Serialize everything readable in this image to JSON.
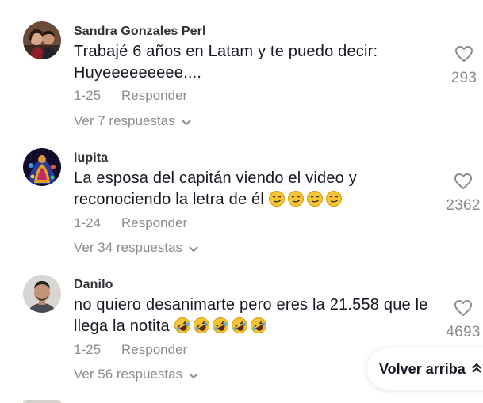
{
  "comments": [
    {
      "author": "Sandra Gonzales Perl",
      "line1": "Trabajé 6 años en Latam y te puedo decir:",
      "line2": "Huyeeeeeeeee....",
      "date": "1-25",
      "reply_label": "Responder",
      "replies_label": "Ver 7 respuestas",
      "likes": "293",
      "emoji_count": 0
    },
    {
      "author": "lupita",
      "line1": "La esposa del capitán viendo el video y",
      "line2": "reconociendo la letra de él",
      "date": "1-24",
      "reply_label": "Responder",
      "replies_label": "Ver 34 respuestas",
      "likes": "2362",
      "emoji": "smirk-emoji",
      "emoji_count": 4
    },
    {
      "author": "Danilo",
      "line1": "no quiero desanimarte pero eres la 21.558 que le",
      "line2": "llega la notita",
      "date": "1-25",
      "reply_label": "Responder",
      "replies_label": "Ver 56 respuestas",
      "likes": "4693",
      "emoji": "rofl-emoji",
      "emoji_count": 5
    }
  ],
  "back_to_top_label": "Volver arriba",
  "colors": {
    "text": "#161823",
    "muted": "#8a8b91",
    "emoji_yellow": "#f6c531"
  }
}
